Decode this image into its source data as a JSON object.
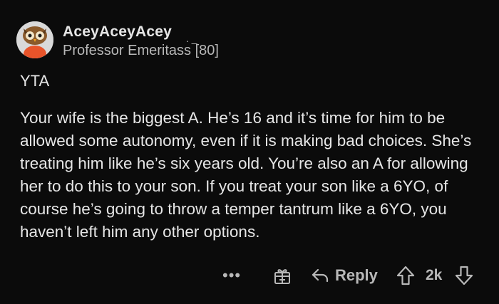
{
  "comment": {
    "username": "AceyAceyAcey",
    "username_suffix": ". _",
    "flair": "Professor Emeritass [80]",
    "verdict": "YTA",
    "body": "Your wife is the biggest A. He’s 16 and it’s time for him to be allowed some autonomy, even if it is making bad choices. She’s treating him like he’s six years old. You’re also an A for allowing her to do this to your son. If you treat your son like a 6YO, of course he’s going to throw a temper tantrum like a 6YO, you haven’t left him any other options."
  },
  "actions": {
    "more": "•••",
    "reply_label": "Reply",
    "vote_count": "2k"
  },
  "icons": {
    "avatar": "avatar-owl-icon",
    "award": "award-gift-icon",
    "reply": "reply-arrow-icon",
    "upvote": "upvote-arrow-icon",
    "downvote": "downvote-arrow-icon"
  },
  "colors": {
    "background": "#0b0b0b",
    "text": "#e6e6e6",
    "muted": "#b8b8b8",
    "avatar_accent": "#e8542a"
  }
}
